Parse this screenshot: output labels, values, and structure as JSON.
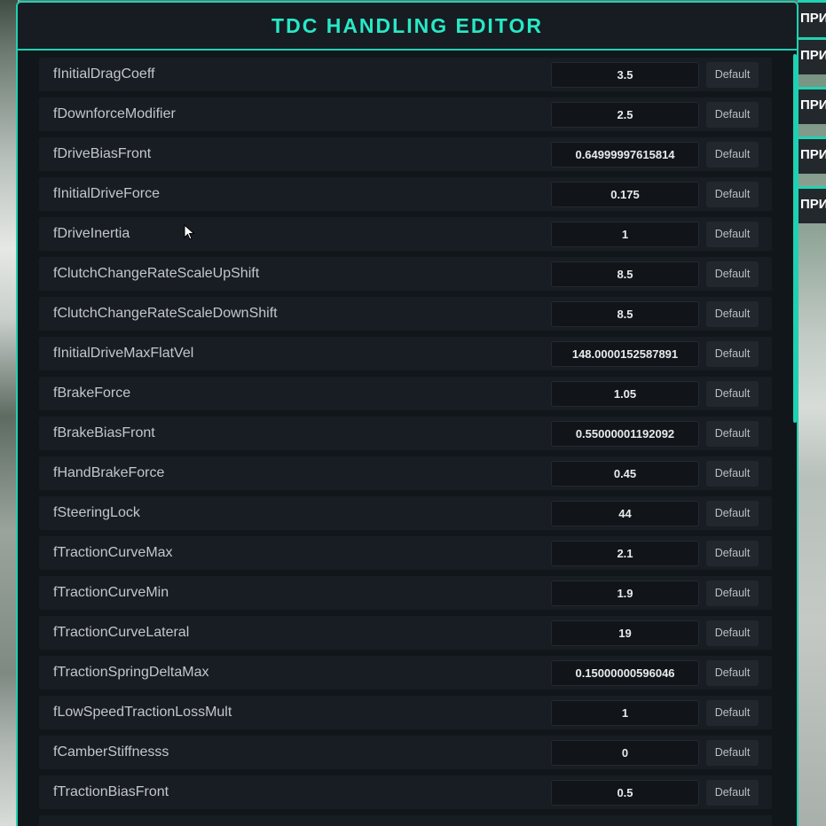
{
  "app": {
    "title": "TDC HANDLING EDITOR"
  },
  "side_tabs": [
    "ПРИЛ",
    "ПРИЛ",
    "ПРИЛ",
    "ПРИЛ",
    "ПРИЛ"
  ],
  "default_label": "Default",
  "colors": {
    "accent": "#1fd1b2",
    "title": "#27e9c6",
    "panel_bg": "#11161b",
    "row_bg": "#181d23",
    "button_bg": "#22272e"
  },
  "rows": [
    {
      "name": "fInitialDragCoeff",
      "value": "3.5"
    },
    {
      "name": "fDownforceModifier",
      "value": "2.5"
    },
    {
      "name": "fDriveBiasFront",
      "value": "0.64999997615814"
    },
    {
      "name": "fInitialDriveForce",
      "value": "0.175"
    },
    {
      "name": "fDriveInertia",
      "value": "1"
    },
    {
      "name": "fClutchChangeRateScaleUpShift",
      "value": "8.5"
    },
    {
      "name": "fClutchChangeRateScaleDownShift",
      "value": "8.5"
    },
    {
      "name": "fInitialDriveMaxFlatVel",
      "value": "148.0000152587891"
    },
    {
      "name": "fBrakeForce",
      "value": "1.05"
    },
    {
      "name": "fBrakeBiasFront",
      "value": "0.55000001192092"
    },
    {
      "name": "fHandBrakeForce",
      "value": "0.45"
    },
    {
      "name": "fSteeringLock",
      "value": "44"
    },
    {
      "name": "fTractionCurveMax",
      "value": "2.1"
    },
    {
      "name": "fTractionCurveMin",
      "value": "1.9"
    },
    {
      "name": "fTractionCurveLateral",
      "value": "19"
    },
    {
      "name": "fTractionSpringDeltaMax",
      "value": "0.15000000596046"
    },
    {
      "name": "fLowSpeedTractionLossMult",
      "value": "1"
    },
    {
      "name": "fCamberStiffnesss",
      "value": "0"
    },
    {
      "name": "fTractionBiasFront",
      "value": "0.5"
    },
    {
      "name": "",
      "value": ""
    }
  ]
}
